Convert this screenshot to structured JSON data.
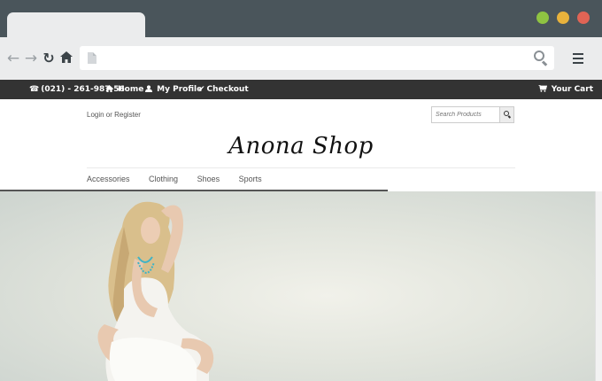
{
  "topbar": {
    "phone": "(021) - 261-987-56",
    "home": "Home",
    "profile": "My Profile",
    "checkout": "Checkout",
    "cart": "Your Cart"
  },
  "header": {
    "login": "Login or Register",
    "search_placeholder": "Search Products",
    "logo": "Anona Shop"
  },
  "nav": {
    "items": [
      "Accessories",
      "Clothing",
      "Shoes",
      "Sports"
    ]
  },
  "colors": {
    "chrome": "#4a555b",
    "topbar": "#333333",
    "traffic_green": "#8fc342",
    "traffic_yellow": "#e8b23c",
    "traffic_red": "#e06455"
  }
}
